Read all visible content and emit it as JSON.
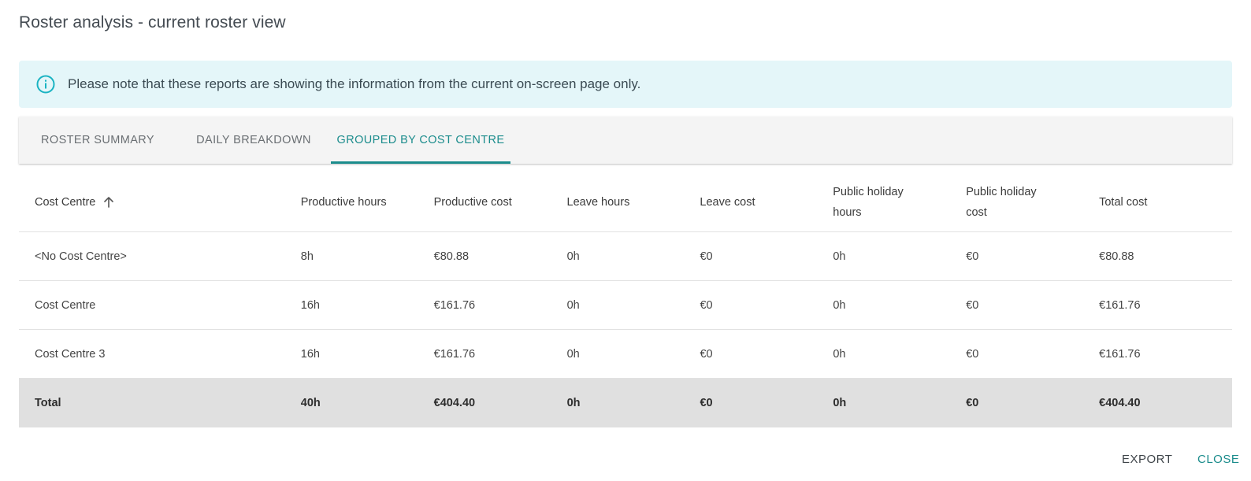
{
  "dialog": {
    "title": "Roster analysis - current roster view"
  },
  "banner": {
    "icon": "info-icon",
    "text": "Please note that these reports are showing the information from the current on-screen page only."
  },
  "tabs": [
    {
      "label": "ROSTER SUMMARY",
      "active": false
    },
    {
      "label": "DAILY BREAKDOWN",
      "active": false
    },
    {
      "label": "GROUPED BY COST CENTRE",
      "active": true
    }
  ],
  "table": {
    "columns": [
      "Cost Centre",
      "Productive hours",
      "Productive cost",
      "Leave hours",
      "Leave cost",
      "Public holiday hours",
      "Public holiday cost",
      "Total cost"
    ],
    "sort_icon": "arrow-up-icon",
    "rows": [
      [
        "<No Cost Centre>",
        "8h",
        "€80.88",
        "0h",
        "€0",
        "0h",
        "€0",
        "€80.88"
      ],
      [
        "Cost Centre",
        "16h",
        "€161.76",
        "0h",
        "€0",
        "0h",
        "€0",
        "€161.76"
      ],
      [
        "Cost Centre 3",
        "16h",
        "€161.76",
        "0h",
        "€0",
        "0h",
        "€0",
        "€161.76"
      ]
    ],
    "total": [
      "Total",
      "40h",
      "€404.40",
      "0h",
      "€0",
      "0h",
      "€0",
      "€404.40"
    ]
  },
  "footer": {
    "export_label": "EXPORT",
    "close_label": "CLOSE"
  },
  "colors": {
    "accent": "#1b8c8c",
    "banner_bg": "#e4f6f9",
    "total_row_bg": "#e0e0e0"
  }
}
